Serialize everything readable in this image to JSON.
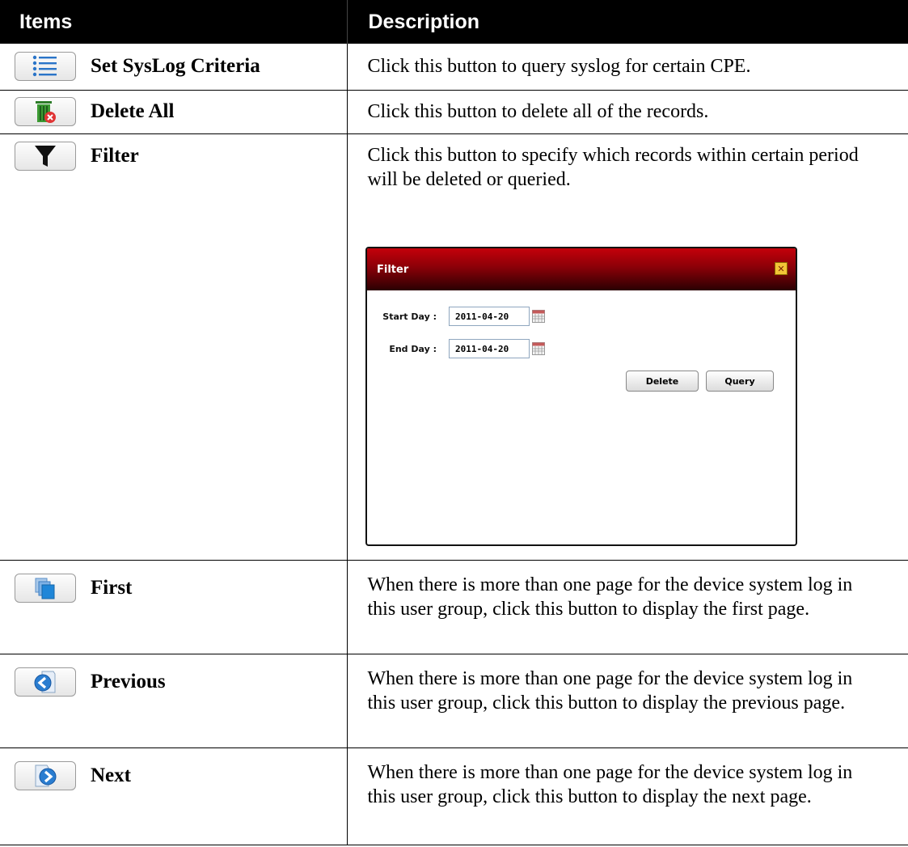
{
  "header": {
    "items": "Items",
    "description": "Description"
  },
  "rows": [
    {
      "label": "Set SysLog Criteria",
      "icon": "list-icon",
      "description": "Click this button to query syslog for certain CPE."
    },
    {
      "label": "Delete All",
      "icon": "trash-delete-icon",
      "description": "Click this button to delete all of the records."
    },
    {
      "label": "Filter",
      "icon": "funnel-icon",
      "description": "Click this button to specify which records within certain period will be deleted or queried."
    },
    {
      "label": "First",
      "icon": "pages-first-icon",
      "description": "When there is more than one page for the device system log in this user group, click this button to display the first page."
    },
    {
      "label": "Previous",
      "icon": "page-previous-icon",
      "description": "When there is more than one page for the device system log in this user group, click this button to display the previous page."
    },
    {
      "label": "Next",
      "icon": "page-next-icon",
      "description": "When there is more than one page for the device system log in this user group, click this button to display the next page."
    }
  ],
  "filter_dialog": {
    "title": "Filter",
    "start_label": "Start Day :",
    "start_value": "2011-04-20",
    "end_label": "End Day :",
    "end_value": "2011-04-20",
    "delete_label": "Delete",
    "query_label": "Query"
  }
}
